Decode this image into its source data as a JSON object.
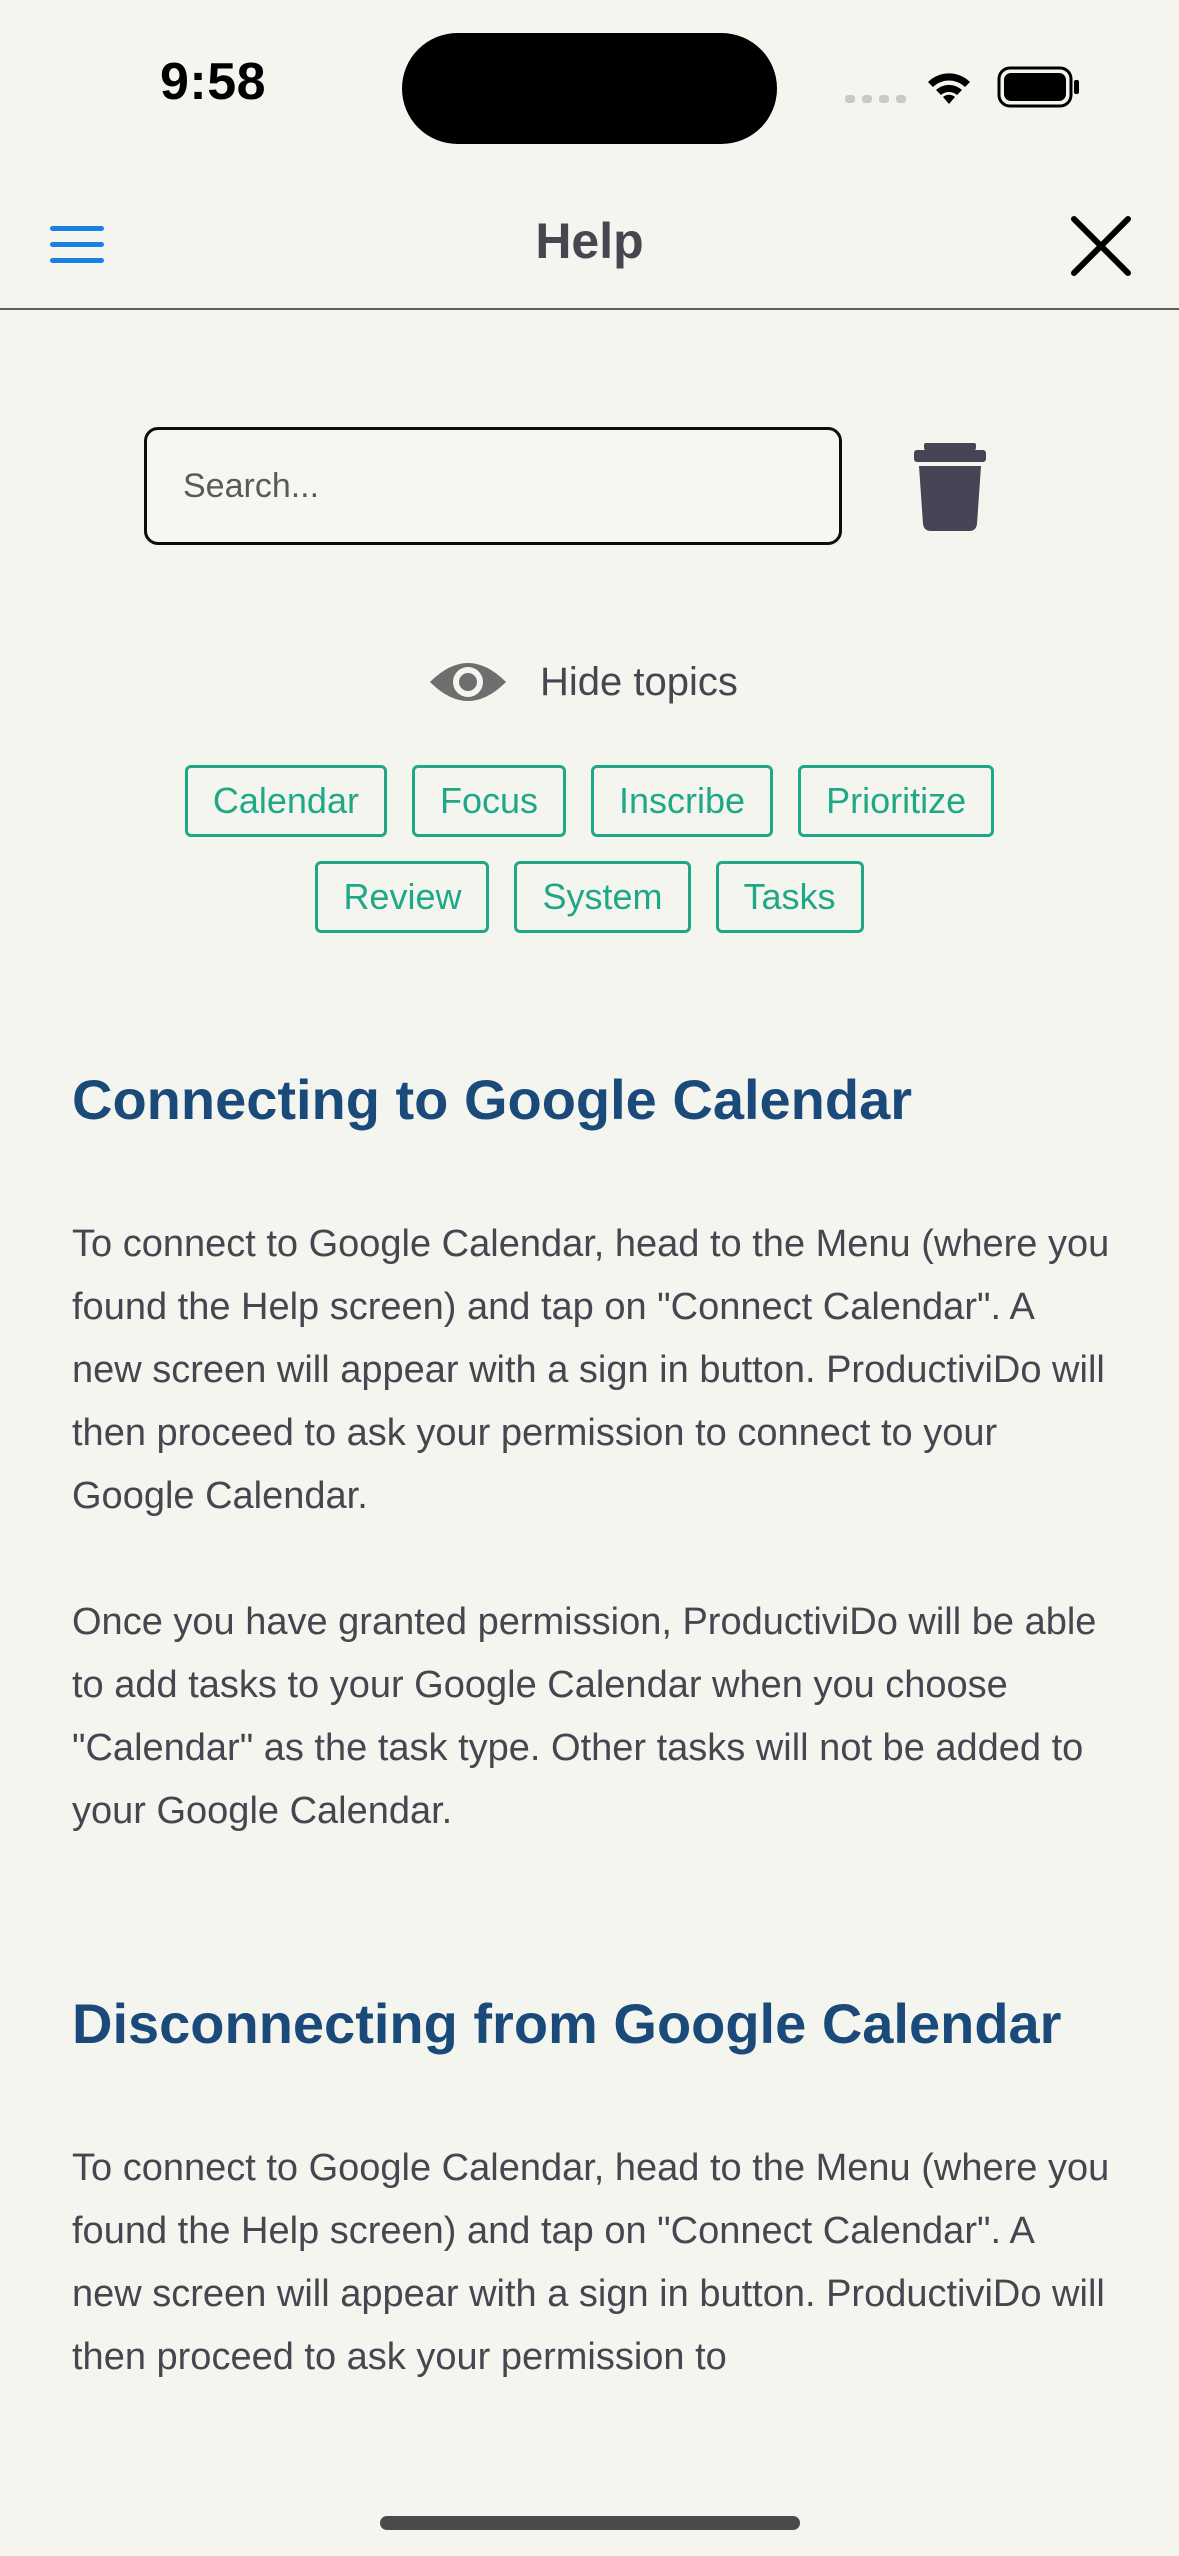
{
  "status_bar": {
    "time": "9:58"
  },
  "header": {
    "title": "Help",
    "menu_icon": "hamburger-icon",
    "close_icon": "close-icon",
    "accent_color": "#1a7ee6"
  },
  "search": {
    "placeholder": "Search...",
    "value": "",
    "clear_icon": "trash-icon"
  },
  "topics": {
    "toggle_label": "Hide topics",
    "toggle_icon": "eye-icon",
    "chip_color": "#1ea888",
    "items": [
      "Calendar",
      "Focus",
      "Inscribe",
      "Prioritize",
      "Review",
      "System",
      "Tasks"
    ]
  },
  "articles": [
    {
      "title": "Connecting to Google Calendar",
      "paragraphs": [
        "To connect to Google Calendar, head to the Menu (where you found the Help screen) and tap on \"Connect Calendar\". A new screen will appear with a sign in button. ProductiviDo will then proceed to ask your permission to connect to your Google Calendar.",
        "Once you have granted permission, ProductiviDo will be able to add tasks to your Google Calendar when you choose \"Calendar\" as the task type. Other tasks will not be added to your Google Calendar."
      ]
    },
    {
      "title": "Disconnecting from Google Calendar",
      "paragraphs": [
        "To connect to Google Calendar, head to the Menu (where you found the Help screen) and tap on \"Connect Calendar\". A new screen will appear with a sign in button. ProductiviDo will then proceed to ask your permission to"
      ]
    }
  ],
  "colors": {
    "background": "#f5f5f0",
    "heading": "#1a4a7a",
    "body_text": "#45464f"
  }
}
